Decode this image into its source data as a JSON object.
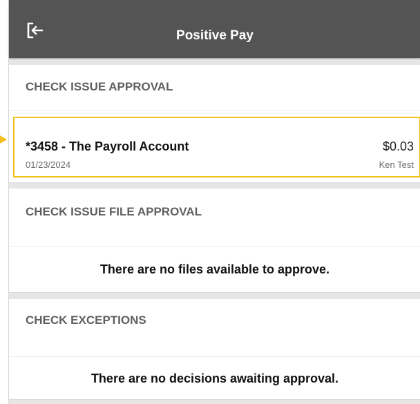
{
  "header": {
    "title": "Positive Pay",
    "back_icon": "logout-arrow-icon"
  },
  "check_issue_approval": {
    "heading": "CHECK ISSUE APPROVAL",
    "items": [
      {
        "account": "*3458 - The Payroll Account",
        "date": "01/23/2024",
        "amount": "$0.03",
        "user": "Ken Test"
      }
    ]
  },
  "check_issue_file_approval": {
    "heading": "CHECK ISSUE FILE APPROVAL",
    "empty_message": "There are no files available to approve."
  },
  "check_exceptions": {
    "heading": "CHECK EXCEPTIONS",
    "empty_message": "There are no decisions awaiting approval."
  },
  "colors": {
    "header_bg": "#545454",
    "highlight": "#f4c01e",
    "page_bg": "#e6e6e6"
  }
}
